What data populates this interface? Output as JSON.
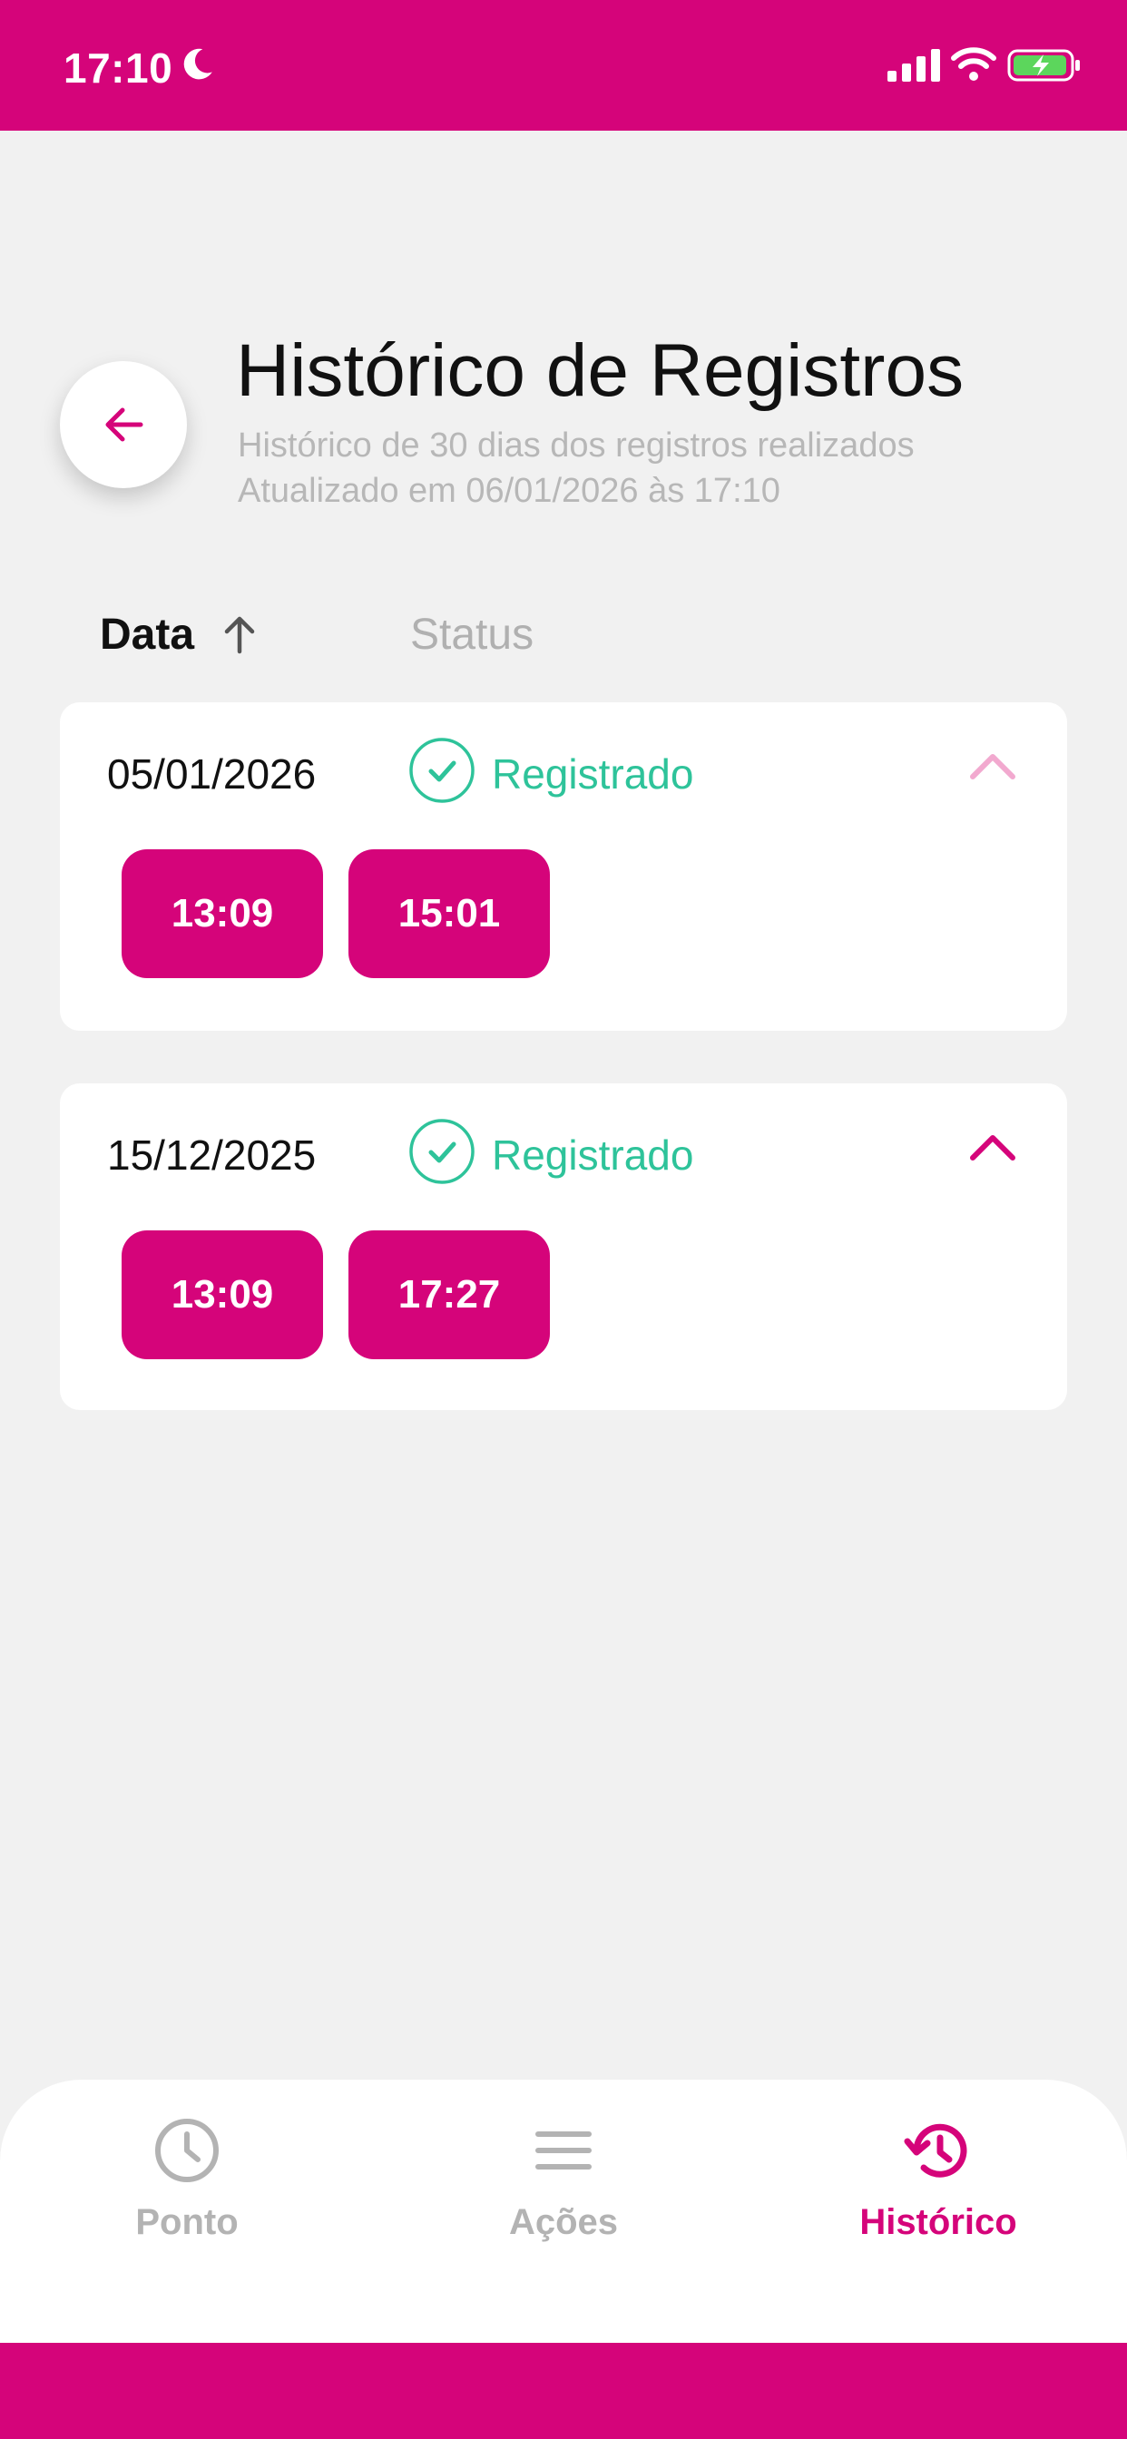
{
  "status_bar": {
    "time": "17:10",
    "icons": [
      "moon-icon",
      "signal-icon",
      "wifi-icon",
      "battery-charging-icon"
    ]
  },
  "header": {
    "title": "Histórico de Registros",
    "subtitle_line1": "Histórico de 30 dias dos registros realizados",
    "subtitle_line2": "Atualizado em 06/01/2026 às 17:10",
    "back_icon": "arrow-left-icon"
  },
  "columns": {
    "date_label": "Data",
    "status_label": "Status",
    "sort_icon": "arrow-up-icon"
  },
  "records": [
    {
      "date": "05/01/2026",
      "status": "Registrado",
      "expanded": true,
      "chevron_color": "#f2a9cf",
      "times": [
        "13:09",
        "15:01"
      ]
    },
    {
      "date": "15/12/2025",
      "status": "Registrado",
      "expanded": true,
      "chevron_color": "#d5047a",
      "times": [
        "13:09",
        "17:27"
      ]
    }
  ],
  "bottom_nav": {
    "items": [
      {
        "label": "Ponto",
        "icon": "clock-icon",
        "active": false
      },
      {
        "label": "Ações",
        "icon": "menu-icon",
        "active": false
      },
      {
        "label": "Histórico",
        "icon": "history-icon",
        "active": true
      }
    ]
  },
  "colors": {
    "brand": "#d5047a",
    "success": "#2ec39a",
    "background": "#f1f1f1",
    "inactive": "#b3b3b3"
  }
}
